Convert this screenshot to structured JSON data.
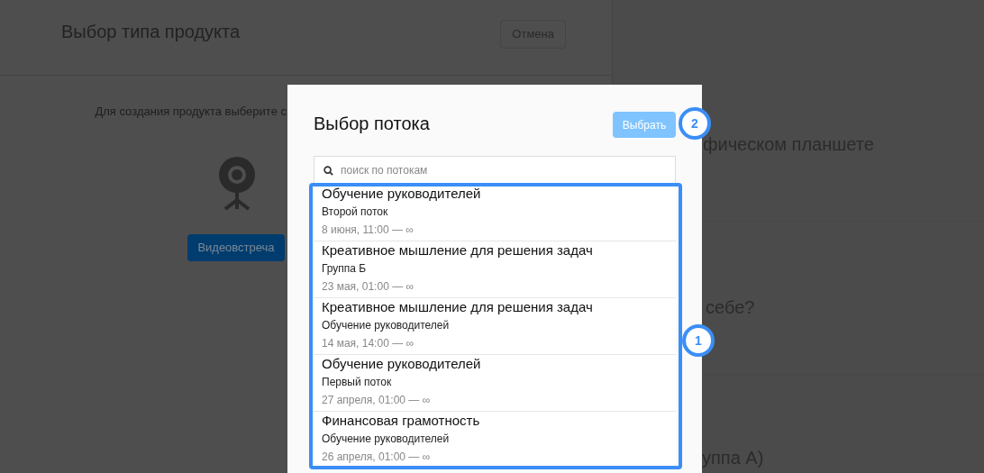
{
  "page": {
    "title": "Выбор типа продукта",
    "cancel_button": "Отмена",
    "hint": "Для создания продукта выберите с",
    "product_button": "Видеовстреча",
    "right_texts": [
      "фическом планшете",
      "себе?",
      "уппа А)"
    ]
  },
  "modal": {
    "title": "Выбор потока",
    "select_button": {
      "label": "Выбрать",
      "disabled": true
    },
    "search": {
      "placeholder": "поиск по потокам"
    },
    "streams": [
      {
        "title": "Обучение руководителей",
        "subtitle": "Второй поток",
        "dates": "8 июня, 11:00 — ∞"
      },
      {
        "title": "Креативное мышление для решения задач",
        "subtitle": "Группа Б",
        "dates": "23 мая, 01:00 — ∞"
      },
      {
        "title": "Креативное мышление для решения задач",
        "subtitle": "Обучение руководителей",
        "dates": "14 мая, 14:00 — ∞"
      },
      {
        "title": "Обучение руководителей",
        "subtitle": "Первый поток",
        "dates": "27 апреля, 01:00 — ∞"
      },
      {
        "title": "Финансовая грамотность",
        "subtitle": "Обучение руководителей",
        "dates": "26 апреля, 01:00 — ∞"
      }
    ]
  },
  "annotations": [
    "1",
    "2"
  ]
}
